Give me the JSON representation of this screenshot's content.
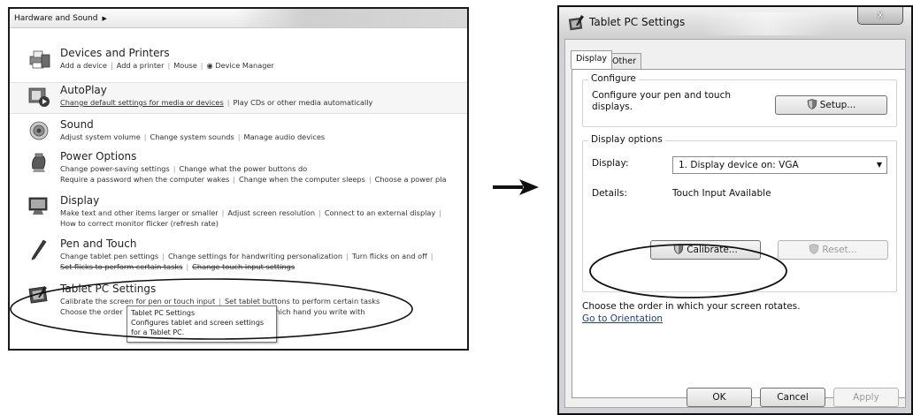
{
  "control_panel": {
    "breadcrumb": "Hardware and Sound",
    "categories": [
      {
        "title": "Devices and Printers",
        "line1": [
          "Add a device",
          "Add a printer",
          "Mouse",
          "Device Manager"
        ],
        "icon": "printer-icon"
      },
      {
        "title": "AutoPlay",
        "line1": [
          "Change default settings for media or devices",
          "Play CDs or other media automatically"
        ],
        "icon": "autoplay-icon"
      },
      {
        "title": "Sound",
        "line1": [
          "Adjust system volume",
          "Change system sounds",
          "Manage audio devices"
        ],
        "icon": "speaker-icon"
      },
      {
        "title": "Power Options",
        "line1": [
          "Change power-saving settings",
          "Change what the power buttons do"
        ],
        "line2": [
          "Require a password when the computer wakes",
          "Change when the computer sleeps",
          "Choose a power pla"
        ],
        "icon": "battery-icon"
      },
      {
        "title": "Display",
        "line1": [
          "Make text and other items larger or smaller",
          "Adjust screen resolution",
          "Connect to an external display"
        ],
        "line2": [
          "How to correct monitor flicker (refresh rate)"
        ],
        "icon": "monitor-icon"
      },
      {
        "title": "Pen and Touch",
        "line1": [
          "Change tablet pen settings",
          "Change settings for handwriting personalization",
          "Turn flicks on and off"
        ],
        "line2": [
          "Set flicks to perform certain tasks",
          "Change touch input settings"
        ],
        "icon": "pen-icon"
      },
      {
        "title": "Tablet PC Settings",
        "line1": [
          "Calibrate the screen for pen or touch input",
          "Set tablet buttons to perform certain tasks"
        ],
        "line2": [
          "Choose the order",
          "which hand you write with"
        ],
        "icon": "tablet-icon"
      }
    ],
    "tooltip": {
      "title": "Tablet PC Settings",
      "line1": "Configures tablet and screen settings",
      "line2": "for a Tablet PC."
    }
  },
  "dialog": {
    "title": "Tablet PC Settings",
    "close_label": "x",
    "tabs": [
      "Display",
      "Other"
    ],
    "configure": {
      "legend": "Configure",
      "text_line1": "Configure your pen and touch",
      "text_line2": "displays.",
      "setup_button": "Setup..."
    },
    "display_options": {
      "legend": "Display options",
      "display_label": "Display:",
      "display_value": "1. Display device on: VGA",
      "details_label": "Details:",
      "details_value": "Touch Input Available",
      "calibrate_button": "Calibrate...",
      "reset_button": "Reset..."
    },
    "orientation": {
      "text": "Choose the order in which your screen rotates.",
      "link": "Go to Orientation"
    },
    "footer": {
      "ok": "OK",
      "cancel": "Cancel",
      "apply": "Apply"
    }
  }
}
